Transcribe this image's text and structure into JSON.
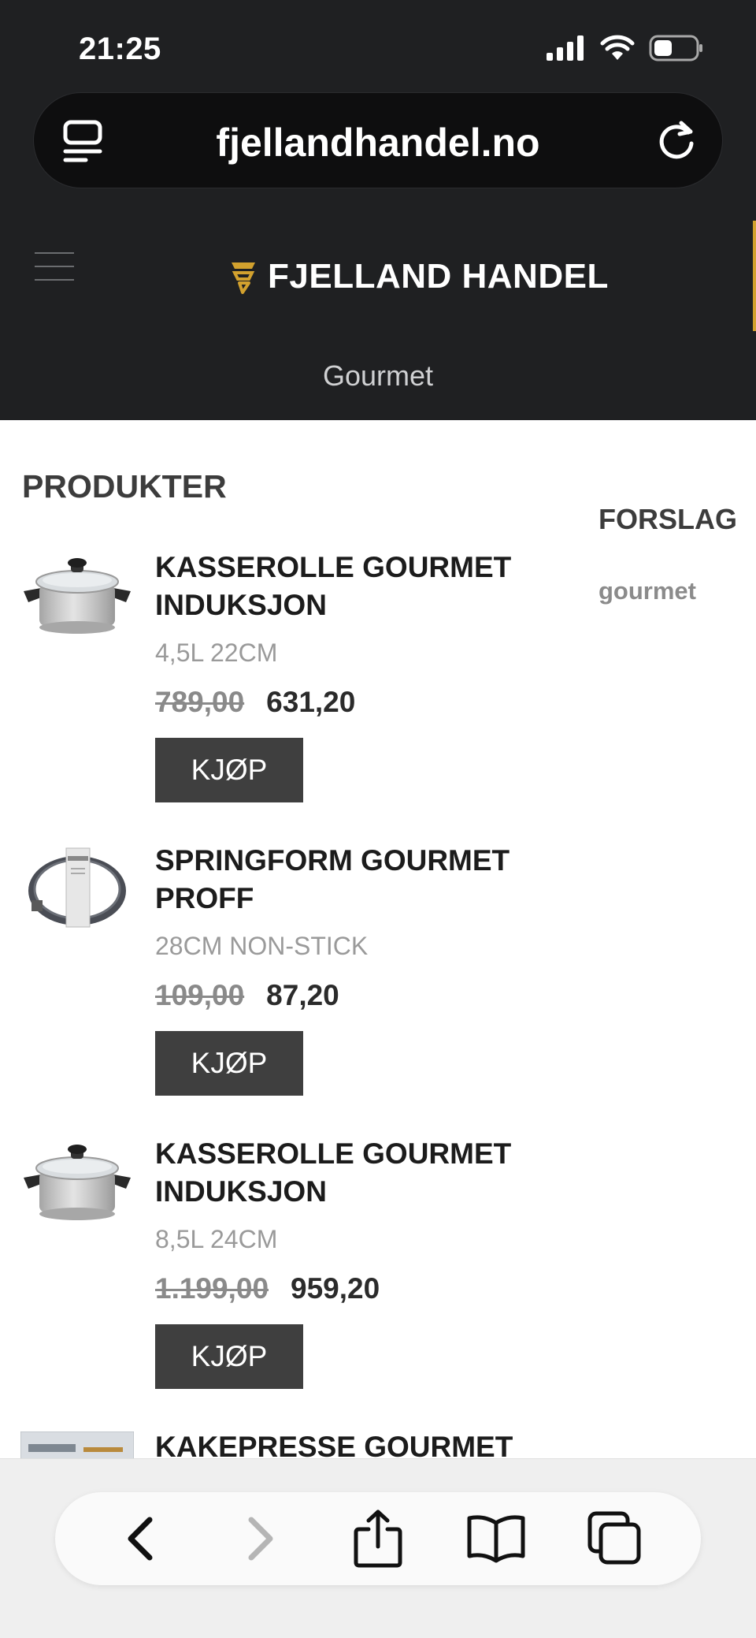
{
  "status_bar": {
    "time": "21:25"
  },
  "browser": {
    "url": "fjellandhandel.no"
  },
  "site": {
    "logo_text": "FJELLAND HANDEL",
    "breadcrumb": "Gourmet",
    "accent_color": "#d2a12e"
  },
  "products_heading": "PRODUKTER",
  "suggestions": {
    "heading": "FORSLAG",
    "items": [
      "gourmet"
    ]
  },
  "products": [
    {
      "name": "KASSEROLLE GOURMET INDUKSJON",
      "variant": "4,5L 22CM",
      "old_price": "789,00",
      "new_price": "631,20",
      "buy_label": "KJØP",
      "image": "saucepan"
    },
    {
      "name": "SPRINGFORM GOURMET PROFF",
      "variant": "28CM NON-STICK",
      "old_price": "109,00",
      "new_price": "87,20",
      "buy_label": "KJØP",
      "image": "springform-pan"
    },
    {
      "name": "KASSEROLLE GOURMET INDUKSJON",
      "variant": "8,5L 24CM",
      "old_price": "1.199,00",
      "new_price": "959,20",
      "buy_label": "KJØP",
      "image": "saucepan"
    },
    {
      "name": "KAKEPRESSE GOURMET",
      "image": "cookie-press-box"
    }
  ]
}
